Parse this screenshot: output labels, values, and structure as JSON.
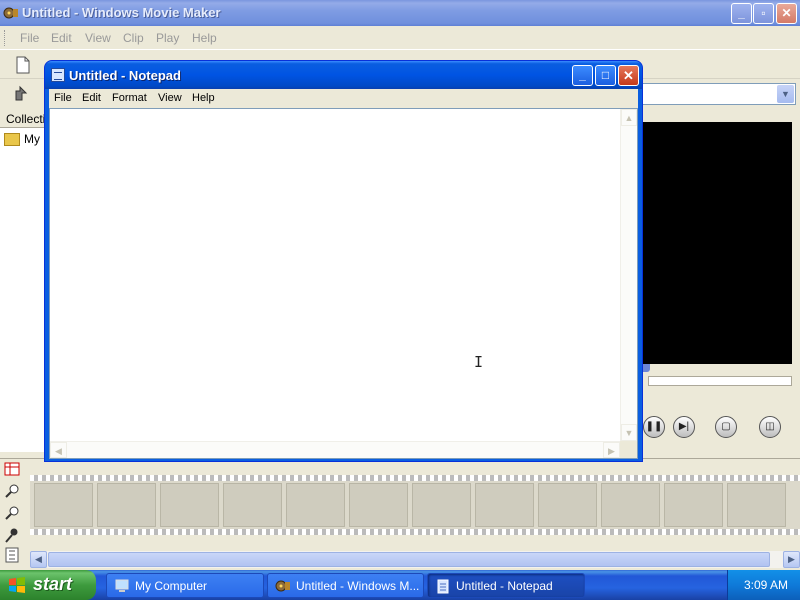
{
  "movie_maker": {
    "title": "Untitled - Windows Movie Maker",
    "menus": [
      "File",
      "Edit",
      "View",
      "Clip",
      "Play",
      "Help"
    ],
    "collections_header": "Collections",
    "collection_item": "My Collections"
  },
  "notepad": {
    "title": "Untitled - Notepad",
    "menus": [
      "File",
      "Edit",
      "Format",
      "View",
      "Help"
    ],
    "content": ""
  },
  "taskbar": {
    "start_label": "start",
    "tasks": [
      {
        "label": "My Computer",
        "icon": "my-computer-icon",
        "active": false
      },
      {
        "label": "Untitled - Windows M...",
        "icon": "movie-maker-icon",
        "active": false
      },
      {
        "label": "Untitled - Notepad",
        "icon": "notepad-icon",
        "active": true
      }
    ],
    "clock": "3:09 AM"
  },
  "colors": {
    "xp_blue": "#0054e3",
    "start_green": "#3e9b3e",
    "close_red": "#c5391a"
  }
}
